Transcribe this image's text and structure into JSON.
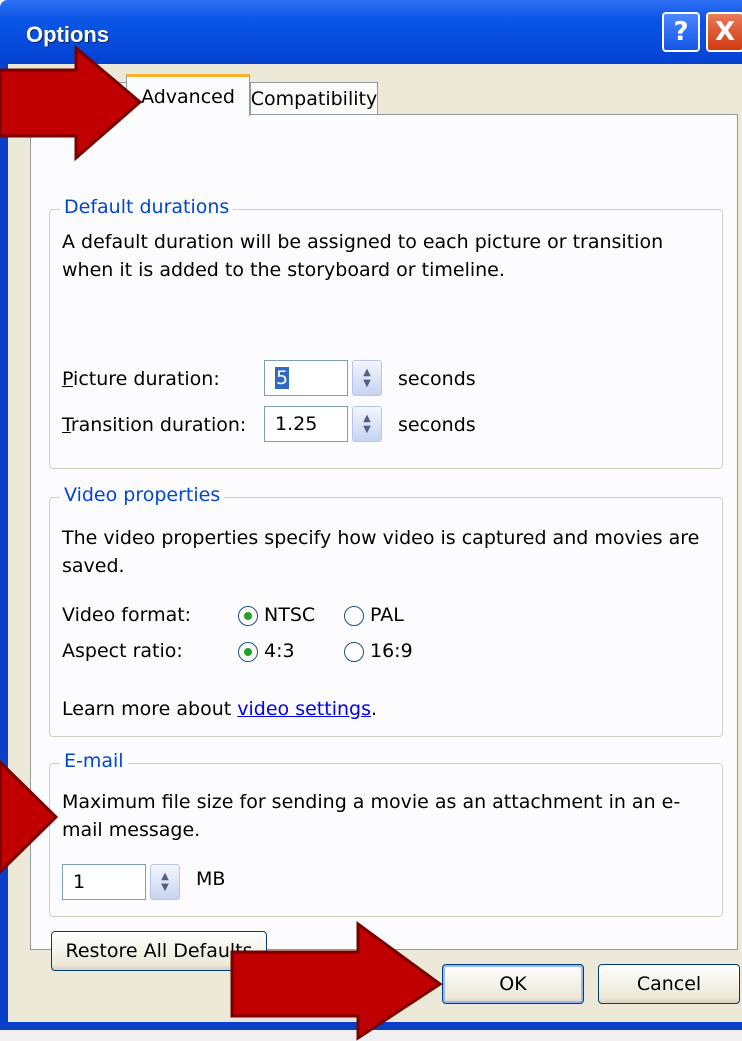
{
  "window": {
    "title": "Options",
    "help_glyph": "?",
    "close_glyph": "X"
  },
  "tabs": [
    {
      "label": "Advanced",
      "active": true
    },
    {
      "label": "Compatibility",
      "active": false
    }
  ],
  "default_durations": {
    "label": "Default durations",
    "description": "A default duration will be assigned to each picture or transition when it is added to the storyboard or timeline.",
    "picture_label": "Picture duration:",
    "picture_value": "5",
    "transition_label": "Transition duration:",
    "transition_value": "1.25",
    "unit": "seconds"
  },
  "video_properties": {
    "label": "Video properties",
    "description": "The video properties specify how video is captured and movies are saved.",
    "format_label": "Video format:",
    "format_options": [
      "NTSC",
      "PAL"
    ],
    "format_selected": "NTSC",
    "aspect_label": "Aspect ratio:",
    "aspect_options": [
      "4:3",
      "16:9"
    ],
    "aspect_selected": "4:3",
    "learn_prefix": "Learn more about ",
    "learn_link": "video settings",
    "learn_suffix": "."
  },
  "email": {
    "label": "E-mail",
    "description": "Maximum file size for sending a movie as an attachment in an e-mail message.",
    "value": "1",
    "unit": "MB"
  },
  "buttons": {
    "restore": "Restore All Defaults",
    "ok": "OK",
    "cancel": "Cancel"
  },
  "colors": {
    "title_bar": "#0a56e6",
    "group_label": "#0046d5",
    "arrow": "#c00000"
  }
}
